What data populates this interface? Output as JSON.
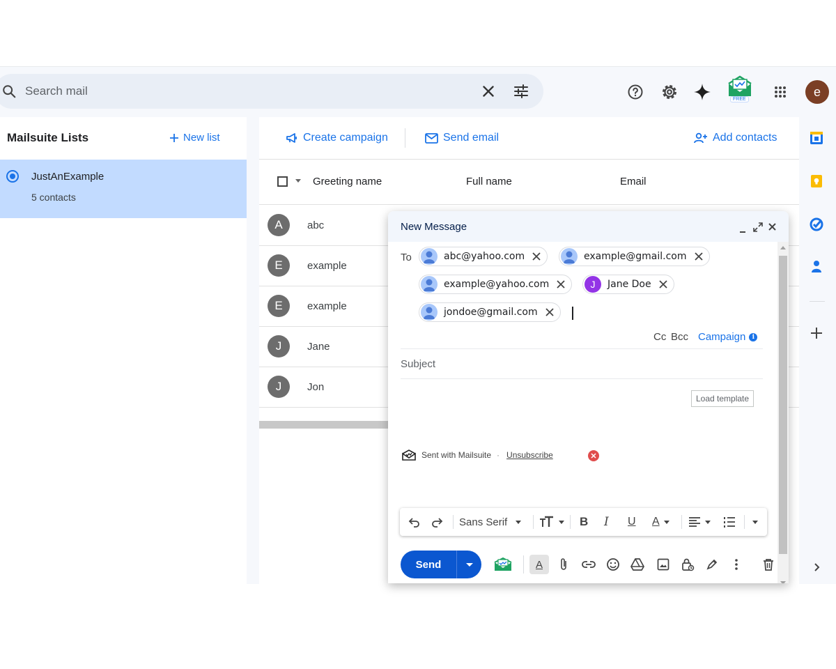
{
  "search": {
    "placeholder": "Search mail"
  },
  "topbar": {
    "avatar_letter": "e",
    "free_badge": "FREE",
    "icons": [
      "help-icon",
      "settings-icon",
      "gemini-spark-icon",
      "mailsuite-logo",
      "apps-grid-icon"
    ]
  },
  "left": {
    "title": "Mailsuite Lists",
    "new_list": "New list",
    "lists": [
      {
        "name": "JustAnExample",
        "count": "5 contacts",
        "selected": true
      }
    ]
  },
  "actions": {
    "create_campaign": "Create campaign",
    "send_email": "Send email",
    "add_contacts": "Add contacts"
  },
  "table": {
    "headers": [
      "Greeting name",
      "Full name",
      "Email"
    ],
    "rows": [
      {
        "initial": "A",
        "greeting": "abc"
      },
      {
        "initial": "E",
        "greeting": "example"
      },
      {
        "initial": "E",
        "greeting": "example"
      },
      {
        "initial": "J",
        "greeting": "Jane"
      },
      {
        "initial": "J",
        "greeting": "Jon"
      }
    ]
  },
  "compose": {
    "title": "New Message",
    "to_label": "To",
    "recipients": [
      {
        "text": "abc@yahoo.com",
        "avatar": "person"
      },
      {
        "text": "example@gmail.com",
        "avatar": "person"
      },
      {
        "text": "example@yahoo.com",
        "avatar": "person"
      },
      {
        "text": "Jane Doe",
        "avatar": "letter",
        "letter": "J",
        "color": "#9334e6"
      },
      {
        "text": "jondoe@gmail.com",
        "avatar": "person"
      }
    ],
    "cc": "Cc",
    "bcc": "Bcc",
    "campaign": "Campaign",
    "info_glyph": "i",
    "subject_placeholder": "Subject",
    "load_template": "Load template",
    "signature": {
      "text": "Sent with Mailsuite",
      "separator": "·",
      "unsubscribe": "Unsubscribe"
    },
    "format": {
      "font": "Sans Serif"
    },
    "send": "Send"
  },
  "colors": {
    "accent": "#1a73e8",
    "send": "#0b57d0",
    "selected_list": "#c2dbff",
    "mailsuite_green": "#1ea362"
  }
}
